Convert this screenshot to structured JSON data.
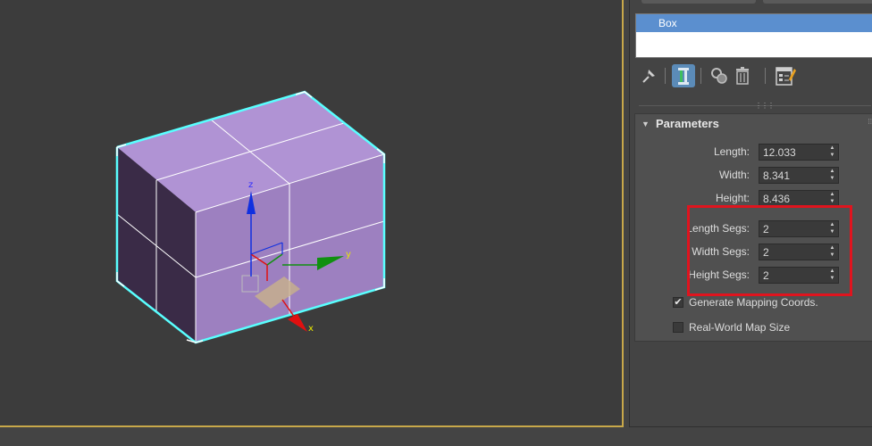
{
  "modifier_stack": {
    "items": [
      "Box"
    ]
  },
  "toolbar": {
    "icons": [
      "pin-stack-icon",
      "show-end-result-icon",
      "make-unique-icon",
      "remove-modifier-icon",
      "configure-modifier-sets-icon"
    ]
  },
  "parameters": {
    "title": "Parameters",
    "length_label": "Length:",
    "length_value": "12.033",
    "width_label": "Width:",
    "width_value": "8.341",
    "height_label": "Height:",
    "height_value": "8.436",
    "length_segs_label": "Length Segs:",
    "length_segs_value": "2",
    "width_segs_label": "Width Segs:",
    "width_segs_value": "2",
    "height_segs_label": "Height Segs:",
    "height_segs_value": "2",
    "gen_mapping_label": "Generate Mapping Coords.",
    "gen_mapping_checked": true,
    "real_world_label": "Real-World Map Size",
    "real_world_checked": false
  },
  "gizmo": {
    "x_label": "x",
    "y_label": "y",
    "z_label": "z"
  },
  "colors": {
    "box_top": "#b093d4",
    "box_front": "#9d80c0",
    "box_side": "#3a2b47",
    "selection_outline": "#59ffff",
    "highlight": "#e0141e",
    "axis_x": "#e01010",
    "axis_y": "#109010",
    "axis_z": "#1030e0"
  }
}
